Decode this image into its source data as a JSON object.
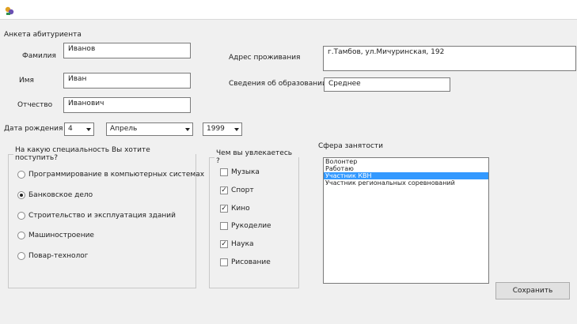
{
  "form": {
    "title": "Анкета абитуриента",
    "surname": {
      "label": "Фамилия",
      "value": "Иванов"
    },
    "name": {
      "label": "Имя",
      "value": "Иван"
    },
    "patronymic": {
      "label": "Отчество",
      "value": "Иванович"
    },
    "birth": {
      "label": "Дата рождения",
      "day": "4",
      "month": "Апрель",
      "year": "1999"
    },
    "address": {
      "label": "Адрес проживания",
      "value": "г.Тамбов, ул.Мичуринская, 192"
    },
    "education": {
      "label": "Сведения об образовании",
      "value": "Среднее"
    }
  },
  "specialty": {
    "title": "На какую специальность Вы хотите поступить?",
    "options": [
      {
        "label": "Программирование в компьютерных системах",
        "selected": false
      },
      {
        "label": "Банковское дело",
        "selected": true
      },
      {
        "label": "Строительство и эксплуатация зданий",
        "selected": false
      },
      {
        "label": "Машиностроение",
        "selected": false
      },
      {
        "label": "Повар-технолог",
        "selected": false
      }
    ]
  },
  "hobbies": {
    "title": "Чем вы увлекаетесь ?",
    "items": [
      {
        "label": "Музыка",
        "checked": false
      },
      {
        "label": "Спорт",
        "checked": true
      },
      {
        "label": "Кино",
        "checked": true
      },
      {
        "label": "Рукоделие",
        "checked": false
      },
      {
        "label": "Наука",
        "checked": true
      },
      {
        "label": "Рисование",
        "checked": false
      }
    ]
  },
  "employment": {
    "title": "Сфера занятости",
    "items": [
      "Волонтер",
      "Работаю",
      "Участник КВН",
      "Участник региональных соревнований"
    ],
    "selected_index": 2
  },
  "save_label": "Сохранить",
  "colors": {
    "selection": "#3399ff",
    "form_bg": "#f0f0f0"
  }
}
